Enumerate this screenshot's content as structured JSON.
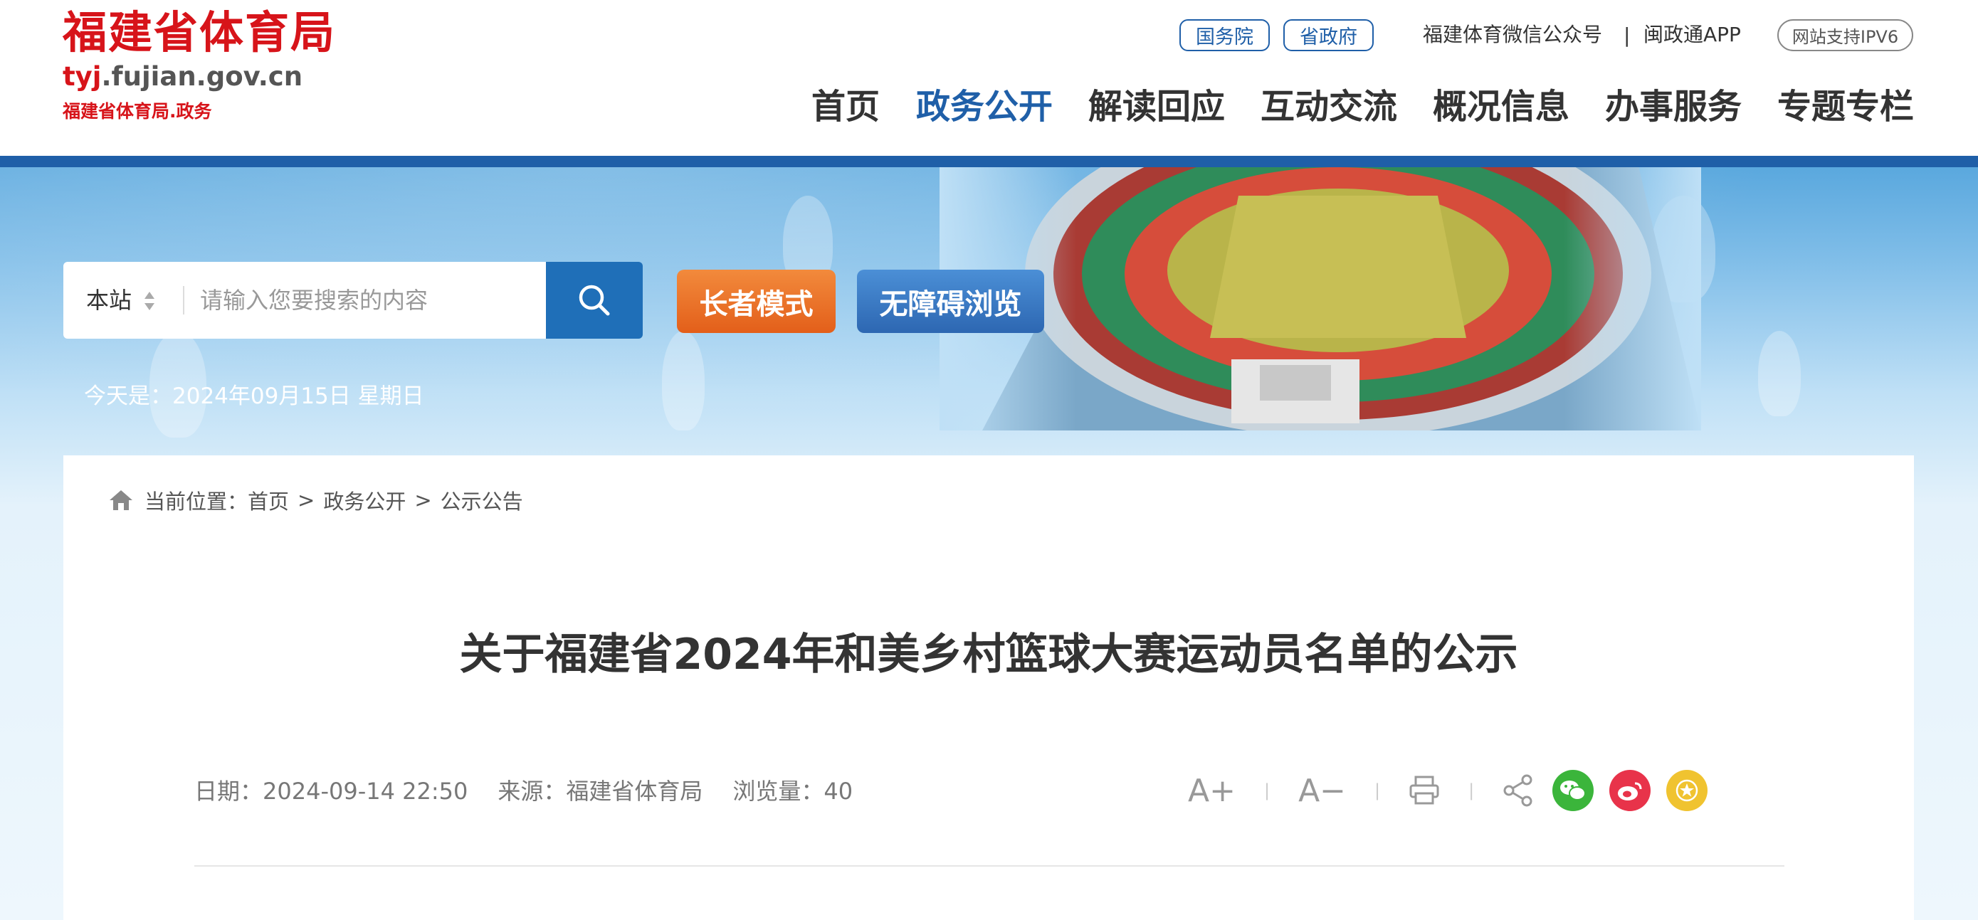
{
  "header": {
    "logo_title": "福建省体育局",
    "logo_domain_prefix": "tyj",
    "logo_domain_rest": ".fujian.gov.cn",
    "logo_subtitle": "福建省体育局.政务",
    "top_pills": [
      "国务院",
      "省政府"
    ],
    "top_links": [
      "福建体育微信公众号",
      "闽政通APP"
    ],
    "divider": "|",
    "ipv6_badge": "网站支持IPV6",
    "nav": [
      {
        "label": "首页",
        "active": false
      },
      {
        "label": "政务公开",
        "active": true
      },
      {
        "label": "解读回应",
        "active": false
      },
      {
        "label": "互动交流",
        "active": false
      },
      {
        "label": "概况信息",
        "active": false
      },
      {
        "label": "办事服务",
        "active": false
      },
      {
        "label": "专题专栏",
        "active": false
      }
    ]
  },
  "banner": {
    "date_text": "今天是：2024年09月15日 星期日",
    "search": {
      "scope": "本站",
      "placeholder": "请输入您要搜索的内容",
      "icon": "search-icon"
    },
    "elder_mode_label": "长者模式",
    "accessible_label": "无障碍浏览"
  },
  "breadcrumb": {
    "prefix": "当前位置：",
    "items": [
      "首页",
      "政务公开",
      "公示公告"
    ],
    "separator": ">"
  },
  "article": {
    "title": "关于福建省2024年和美乡村篮球大赛运动员名单的公示",
    "date": "日期：2024-09-14 22:50",
    "source": "来源：福建省体育局",
    "views": "浏览量：40"
  },
  "tools": {
    "font_increase": "A+",
    "font_decrease": "A−",
    "divider": "|",
    "icons": [
      "print-icon",
      "share-icon",
      "wechat-icon",
      "weibo-icon",
      "favorite-icon"
    ]
  },
  "colors": {
    "brand_red": "#d7141a",
    "brand_blue": "#1f5fa8",
    "elder_orange": "#e96a24",
    "wechat_green": "#3bb53b",
    "weibo_red": "#e8334a",
    "favorite_yellow": "#f0c330"
  }
}
